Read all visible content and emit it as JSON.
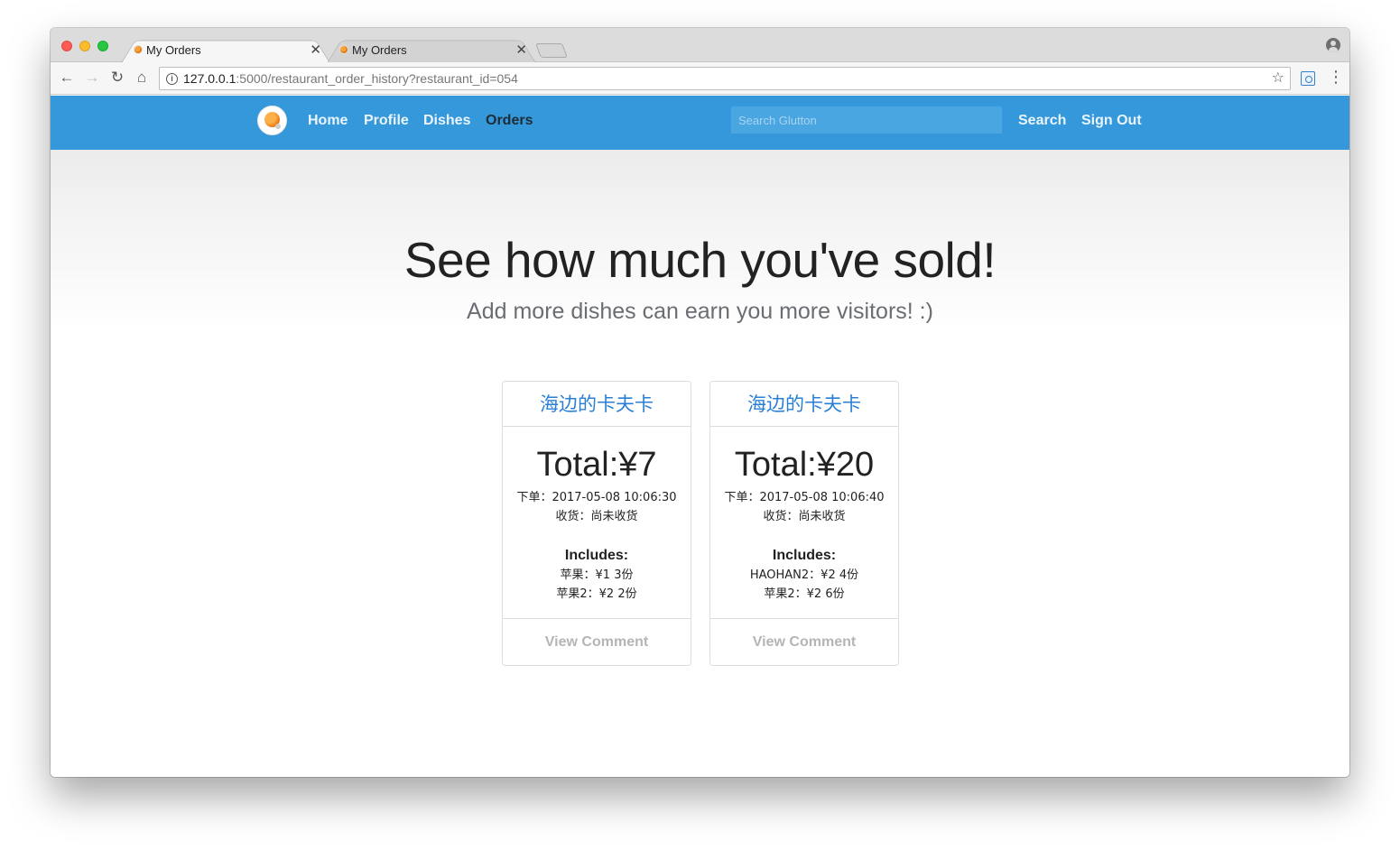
{
  "browser": {
    "tabs": [
      {
        "title": "My Orders",
        "active": true
      },
      {
        "title": "My Orders",
        "active": false
      }
    ],
    "url": {
      "host": "127.0.0.1",
      "path": ":5000/restaurant_order_history?restaurant_id=054"
    }
  },
  "navbar": {
    "links": {
      "home": "Home",
      "profile": "Profile",
      "dishes": "Dishes",
      "orders": "Orders"
    },
    "active": "Orders",
    "search_placeholder": "Search Glutton",
    "search_button": "Search",
    "sign_out": "Sign Out",
    "color": "#3498db"
  },
  "page": {
    "headline": "See how much you've sold!",
    "subheadline": "Add more dishes can earn you more visitors! :)"
  },
  "orders": [
    {
      "restaurant": "海边的卡夫卡",
      "total": "Total:¥7",
      "ordered": "下单：2017-05-08 10:06:30",
      "received": "收货：尚未收货",
      "includes_label": "Includes:",
      "items": [
        "苹果：¥1  3份",
        "苹果2：¥2  2份"
      ],
      "view_comment": "View Comment"
    },
    {
      "restaurant": "海边的卡夫卡",
      "total": "Total:¥20",
      "ordered": "下单：2017-05-08 10:06:40",
      "received": "收货：尚未收货",
      "includes_label": "Includes:",
      "items": [
        "HAOHAN2：¥2  4份",
        "苹果2：¥2  6份"
      ],
      "view_comment": "View Comment"
    }
  ]
}
